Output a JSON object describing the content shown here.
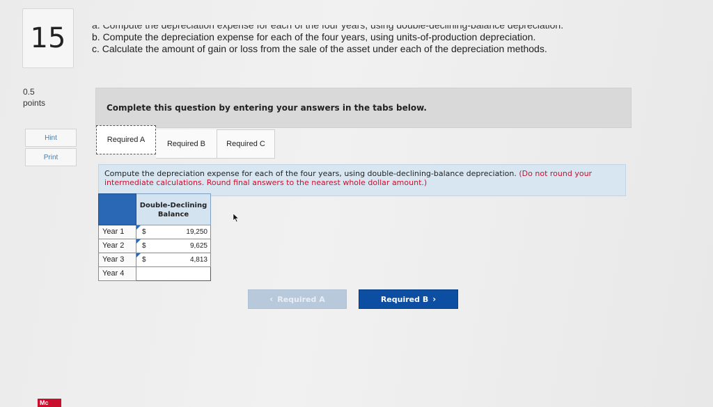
{
  "question": {
    "number": "15",
    "instructions": [
      "a. Compute the depreciation expense for each of the four years, using double-declining-balance depreciation.",
      "b. Compute the depreciation expense for each of the four years, using units-of-production depreciation.",
      "c. Calculate the amount of gain or loss from the sale of the asset under each of the depreciation methods."
    ],
    "points_value": "0.5",
    "points_label": "points"
  },
  "sidebar": {
    "hint_label": "Hint",
    "print_label": "Print"
  },
  "banner": {
    "text": "Complete this question by entering your answers in the tabs below."
  },
  "tabs": [
    {
      "label": "Required A",
      "active": true
    },
    {
      "label": "Required B",
      "active": false
    },
    {
      "label": "Required C",
      "active": false
    }
  ],
  "prompt": {
    "text": "Compute the depreciation expense for each of the four years, using double-declining-balance depreciation.",
    "note": "(Do not round your intermediate calculations. Round final answers to the nearest whole dollar amount.)"
  },
  "table": {
    "column_header": "Double-Declining Balance",
    "rows": [
      {
        "label": "Year 1",
        "currency": "$",
        "value": "19,250"
      },
      {
        "label": "Year 2",
        "currency": "$",
        "value": "9,625"
      },
      {
        "label": "Year 3",
        "currency": "$",
        "value": "4,813"
      },
      {
        "label": "Year 4",
        "currency": "",
        "value": ""
      }
    ]
  },
  "navigation": {
    "prev_label": "Required A",
    "next_label": "Required B",
    "prev_icon": "chevron-left-icon",
    "next_icon": "chevron-right-icon"
  },
  "branding": {
    "logo_text": "Mc",
    "accent_color": "#0b4ea2",
    "note_color": "#c8102e"
  }
}
